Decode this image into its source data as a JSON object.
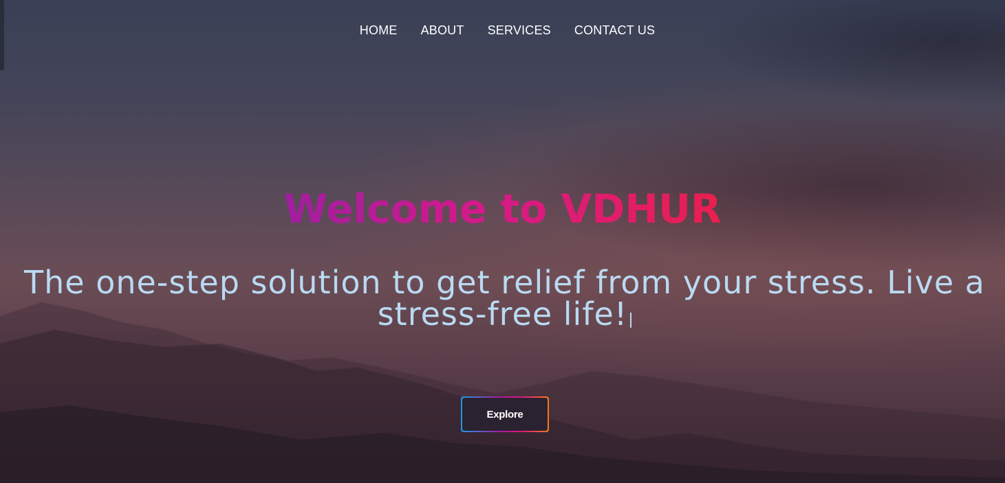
{
  "nav": {
    "items": [
      {
        "label": "HOME"
      },
      {
        "label": "ABOUT"
      },
      {
        "label": "SERVICES"
      },
      {
        "label": "CONTACT US"
      }
    ]
  },
  "hero": {
    "title": "Welcome to VDHUR",
    "tagline": "The one-step solution to get relief from your stress. Live a stress-free life!",
    "button_label": "Explore"
  },
  "colors": {
    "title_gradient": [
      "#a01ea0",
      "#d51a8a",
      "#ea1f4f"
    ],
    "tagline": "#b9daf2",
    "button_border_gradient": [
      "#1e9ae6",
      "#a51aa0",
      "#e2187a",
      "#f47a20"
    ],
    "nav_text": "#ffffff"
  }
}
